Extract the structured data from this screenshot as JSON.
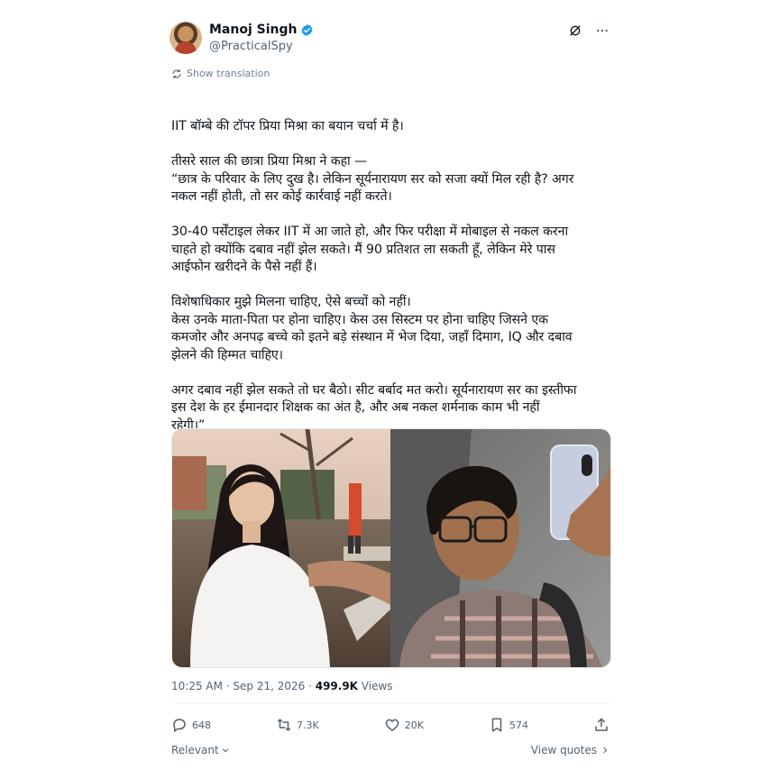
{
  "author": {
    "name": "Manoj Singh",
    "handle": "@PracticalSpy",
    "verified": true
  },
  "show_translation": "Show translation",
  "tweet_lines": [
    "IIT बॉम्बे की टॉपर प्रिया मिश्रा का बयान चर्चा में है।",
    "",
    "तीसरे साल की छात्रा प्रिया मिश्रा ने कहा —",
    "“छात्र के परिवार के लिए दुख है। लेकिन सूर्यनारायण सर को सजा क्यों मिल रही है? अगर",
    "नकल नहीं होती, तो सर कोई कार्रवाई नहीं करते।",
    "",
    "30-40 पर्सेंटाइल लेकर IIT में आ जाते हो, और फिर परीक्षा में मोबाइल से नकल करना",
    "चाहते हो क्योंकि दबाव नहीं झेल सकते। मैं 90 प्रतिशत ला सकती हूँ, लेकिन मेरे पास",
    "आईफोन खरीदने के पैसे नहीं हैं।",
    "",
    "विशेषाधिकार मुझे मिलना चाहिए, ऐसे बच्चों को नहीं।",
    "केस उनके माता-पिता पर होना चाहिए। केस उस सिस्टम पर होना चाहिए जिसने एक",
    "कमजोर और अनपढ़ बच्चे को इतने बड़े संस्थान में भेज दिया, जहाँ दिमाग, IQ और दबाव",
    "झेलने की हिम्मत चाहिए।",
    "",
    "अगर दबाव नहीं झेल सकते तो घर बैठो। सीट बर्बाद मत करो। सूर्यनारायण सर का इस्तीफा",
    "इस देश के हर ईमानदार शिक्षक का अंत है, और अब नकल शर्मनाक काम भी नहीं",
    "रहेगी।”"
  ],
  "timestamp": "10:25 AM · Sep 21, 2026 · ",
  "views_count": "499.9K",
  "views_label": " Views",
  "actions": {
    "replies": "648",
    "reposts": "7.3K",
    "likes": "20K",
    "bookmarks": "574"
  },
  "footer": {
    "relevant": "Relevant",
    "view_quotes": "View quotes"
  },
  "icons": {
    "verified": "verified-badge-icon",
    "grok": "grok-icon",
    "more": "more-icon",
    "translate": "translate-icon",
    "reply": "reply-icon",
    "repost": "repost-icon",
    "like": "like-icon",
    "bookmark": "bookmark-icon",
    "share": "share-icon"
  },
  "colors": {
    "verified_blue": "#1d9bf0",
    "secondary_text": "#536471"
  }
}
